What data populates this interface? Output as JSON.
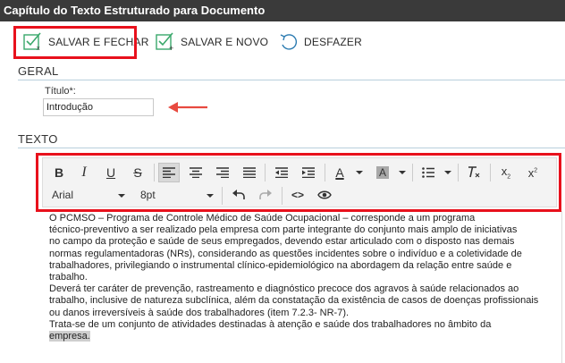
{
  "window": {
    "title": "Capítulo do Texto Estruturado para Documento"
  },
  "actions": {
    "save_close": "SALVAR E FECHAR",
    "save_new": "SALVAR E NOVO",
    "undo": "DESFAZER"
  },
  "sections": {
    "general": "GERAL",
    "text": "TEXTO"
  },
  "title_field": {
    "label": "Título*:",
    "value": "Introdução"
  },
  "toolbar": {
    "font": "Arial",
    "size": "8pt",
    "color_letter": "A",
    "bg_letter": "A",
    "code": "<>"
  },
  "editor": {
    "lines": [
      "O PCMSO – Programa de Controle Médico de Saúde Ocupacional – corresponde a um programa",
      "técnico-preventivo a ser realizado pela empresa com parte integrante do conjunto mais amplo de iniciativas",
      "no campo da proteção e saúde de seus empregados, devendo estar articulado com o disposto nas demais",
      "normas regulamentadoras (NRs), considerando as questões incidentes sobre o indivíduo e a coletividade de",
      "trabalhadores, privilegiando o instrumental clínico-epidemiológico na abordagem da relação entre saúde e",
      "trabalho.",
      "Deverá ter caráter de prevenção, rastreamento e diagnóstico precoce dos agravos à saúde relacionados ao",
      "trabalho, inclusive de natureza subclínica, além da constatação da existência de casos de doenças profissionais",
      "ou danos irreversíveis à saúde dos trabalhadores (item 7.2.3- NR-7).",
      "Trata-se de um conjunto de atividades destinadas à atenção e saúde dos trabalhadores no âmbito da",
      "empresa."
    ]
  },
  "colors": {
    "highlight": "#e8111c",
    "accent_green": "#3aa86b",
    "titlebar": "#3a3a3a"
  }
}
